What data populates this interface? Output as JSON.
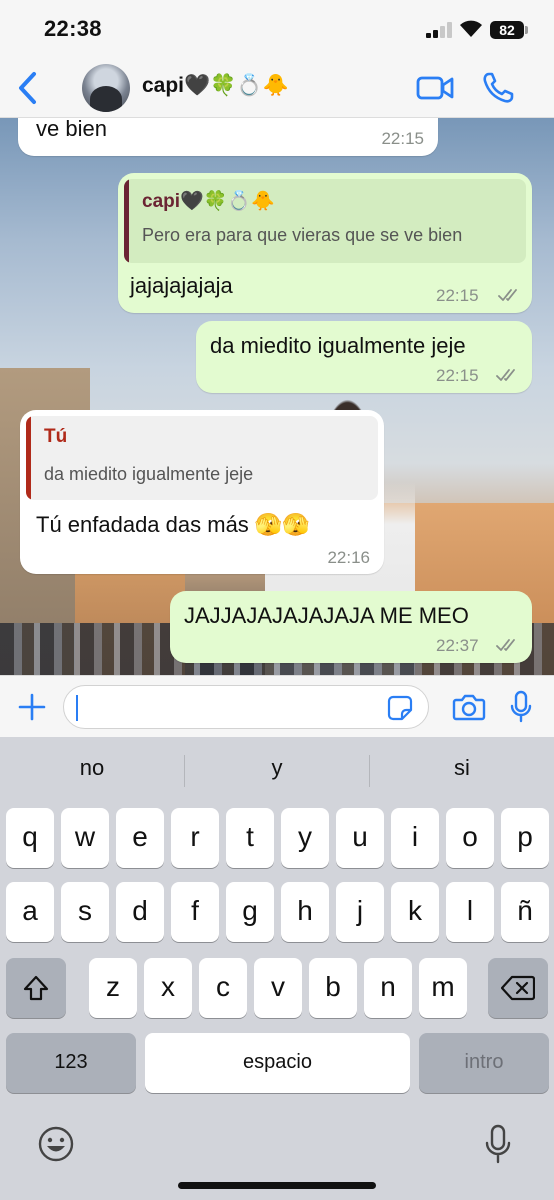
{
  "status_bar": {
    "time": "22:38",
    "battery": "82"
  },
  "header": {
    "contact_name": "capi🖤🍀💍🐥"
  },
  "messages": [
    {
      "direction": "in",
      "text": "ve bien",
      "time": "22:15"
    },
    {
      "direction": "out",
      "quote_author": "capi🖤🍀💍🐥",
      "quote_text": "Pero era para que vieras que se ve bien",
      "text": "jajajajajaja",
      "time": "22:15",
      "read": true
    },
    {
      "direction": "out",
      "text": "da miedito igualmente jeje",
      "time": "22:15",
      "read": true
    },
    {
      "direction": "in",
      "quote_author": "Tú",
      "quote_text": "da miedito igualmente jeje",
      "text": "Tú enfadada das más 🫣🫣",
      "time": "22:16"
    },
    {
      "direction": "out",
      "text": "JAJJAJAJAJAJAJA ME MEO",
      "time": "22:37",
      "read": true
    }
  ],
  "colors": {
    "accent": "#2a7ef4",
    "quote_self": "#b02a1a",
    "quote_contact": "#6b2533",
    "read_ticks": "#8a8f8a"
  },
  "input": {
    "value": "",
    "placeholder": ""
  },
  "keyboard": {
    "suggestions": [
      "no",
      "y",
      "si"
    ],
    "row1": [
      "q",
      "w",
      "e",
      "r",
      "t",
      "y",
      "u",
      "i",
      "o",
      "p"
    ],
    "row2": [
      "a",
      "s",
      "d",
      "f",
      "g",
      "h",
      "j",
      "k",
      "l",
      "ñ"
    ],
    "row3": [
      "z",
      "x",
      "c",
      "v",
      "b",
      "n",
      "m"
    ],
    "numbers_label": "123",
    "space_label": "espacio",
    "return_label": "intro"
  },
  "icons": [
    "back-chevron-icon",
    "video-call-icon",
    "phone-icon",
    "plus-icon",
    "sticker-icon",
    "camera-icon",
    "mic-icon",
    "shift-icon",
    "backspace-icon",
    "emoji-icon",
    "dictation-mic-icon"
  ]
}
